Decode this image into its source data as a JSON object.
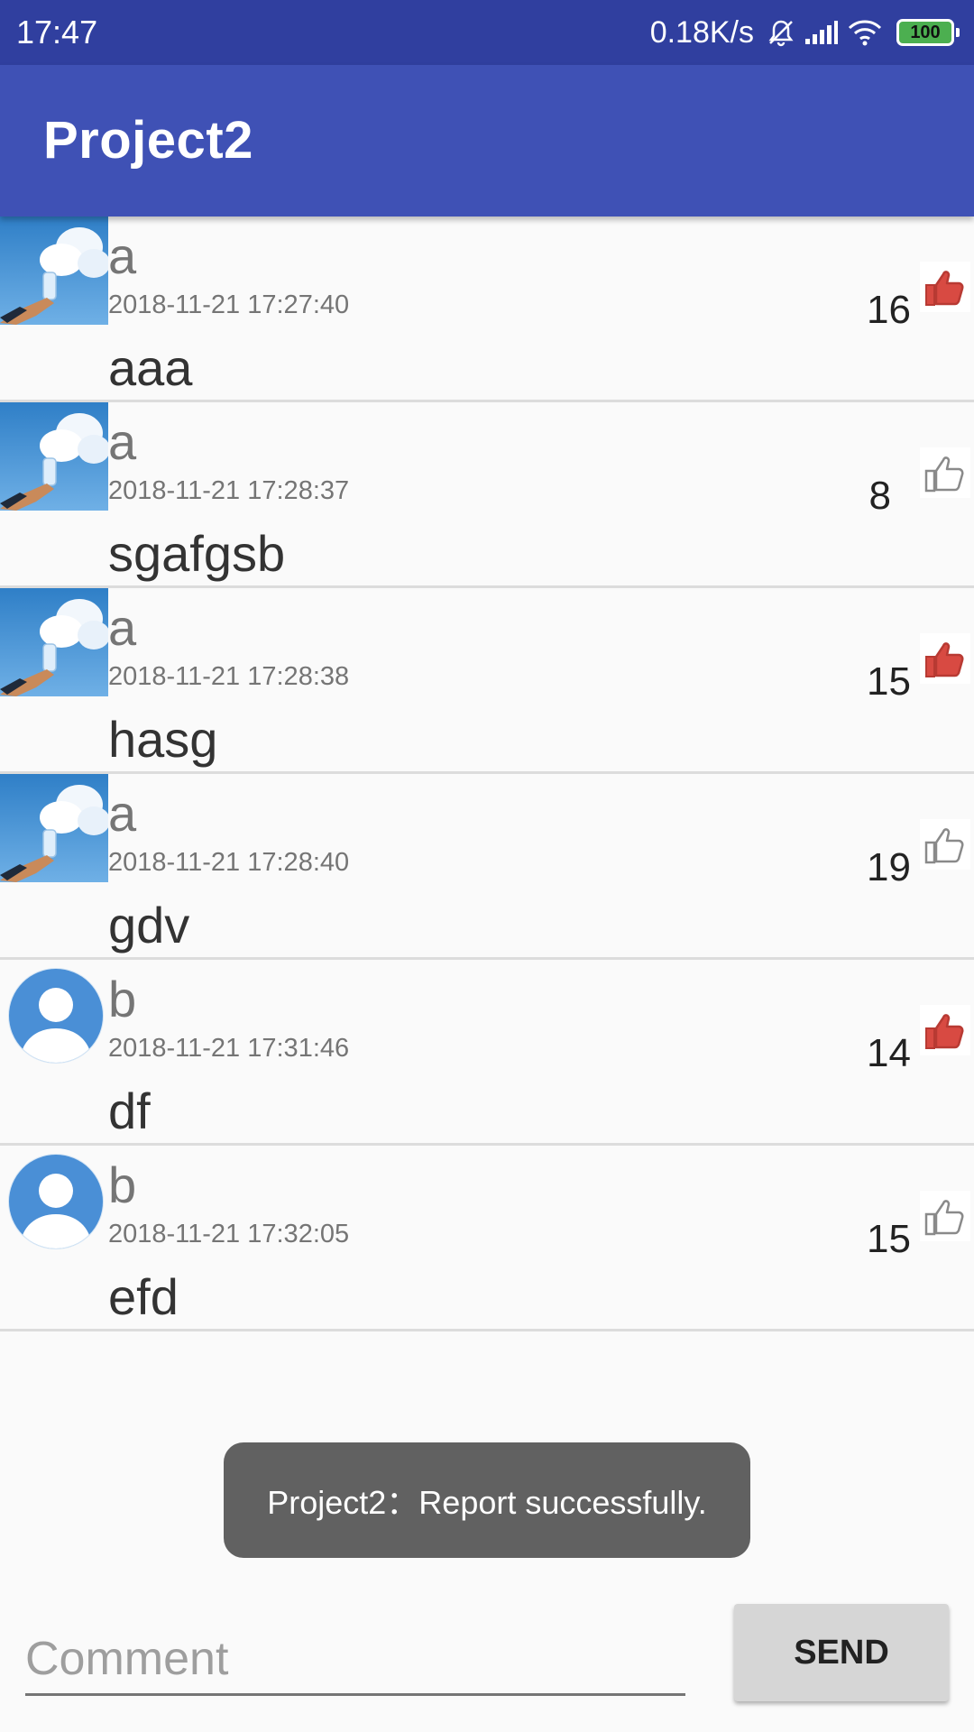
{
  "status_bar": {
    "time": "17:47",
    "network_speed": "0.18K/s",
    "battery": "100",
    "icons": [
      "mute-bell-icon",
      "signal-icon",
      "wifi-icon",
      "battery-icon"
    ]
  },
  "app_bar": {
    "title": "Project2"
  },
  "posts": [
    {
      "avatar": "sky-photo-avatar",
      "name": "a",
      "time": "2018-11-21 17:27:40",
      "comment": "aaa",
      "likes": "16",
      "liked": true
    },
    {
      "avatar": "sky-photo-avatar",
      "name": "a",
      "time": "2018-11-21 17:28:37",
      "comment": "sgafgsb",
      "likes": "8",
      "liked": false
    },
    {
      "avatar": "sky-photo-avatar",
      "name": "a",
      "time": "2018-11-21 17:28:38",
      "comment": "hasg",
      "likes": "15",
      "liked": true
    },
    {
      "avatar": "sky-photo-avatar",
      "name": "a",
      "time": "2018-11-21 17:28:40",
      "comment": "gdv",
      "likes": "19",
      "liked": false
    },
    {
      "avatar": "default-person-avatar",
      "name": "b",
      "time": "2018-11-21 17:31:46",
      "comment": "df",
      "likes": "14",
      "liked": true
    },
    {
      "avatar": "default-person-avatar",
      "name": "b",
      "time": "2018-11-21 17:32:05",
      "comment": "efd",
      "likes": "15",
      "liked": false
    }
  ],
  "toast": {
    "message": "Project2：Report successfully."
  },
  "composer": {
    "placeholder": "Comment",
    "value": "",
    "send_label": "SEND"
  },
  "colors": {
    "status_bar": "#303f9f",
    "app_bar": "#3f51b5",
    "liked": "#d84a42",
    "unliked": "#8a8a8a",
    "avatar_blue": "#4a8fd6"
  }
}
